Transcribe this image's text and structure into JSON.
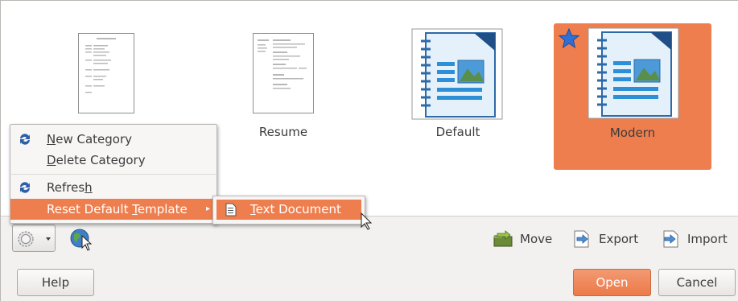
{
  "templates": [
    {
      "label": ""
    },
    {
      "label": "Resume"
    },
    {
      "label": "Default"
    },
    {
      "label": "Modern"
    }
  ],
  "context_menu": {
    "items": [
      {
        "pre": "",
        "u": "N",
        "post": "ew Category"
      },
      {
        "pre": "",
        "u": "D",
        "post": "elete Category"
      },
      {
        "pre": "Refres",
        "u": "h",
        "post": ""
      },
      {
        "pre": "Reset Default ",
        "u": "T",
        "post": "emplate"
      }
    ],
    "submenu_pre": "",
    "submenu_u": "T",
    "submenu_post": "ext Document"
  },
  "toolbar": {
    "move": "Move",
    "export": "Export",
    "import": "Import"
  },
  "buttons": {
    "help": "Help",
    "open": "Open",
    "cancel": "Cancel"
  },
  "colors": {
    "accent": "#ef7e4e",
    "star": "#2f6fd6"
  },
  "icons": [
    "refresh-icon",
    "document-icon",
    "gear-icon",
    "globe-icon",
    "move-icon",
    "export-icon",
    "import-icon",
    "star-icon"
  ]
}
